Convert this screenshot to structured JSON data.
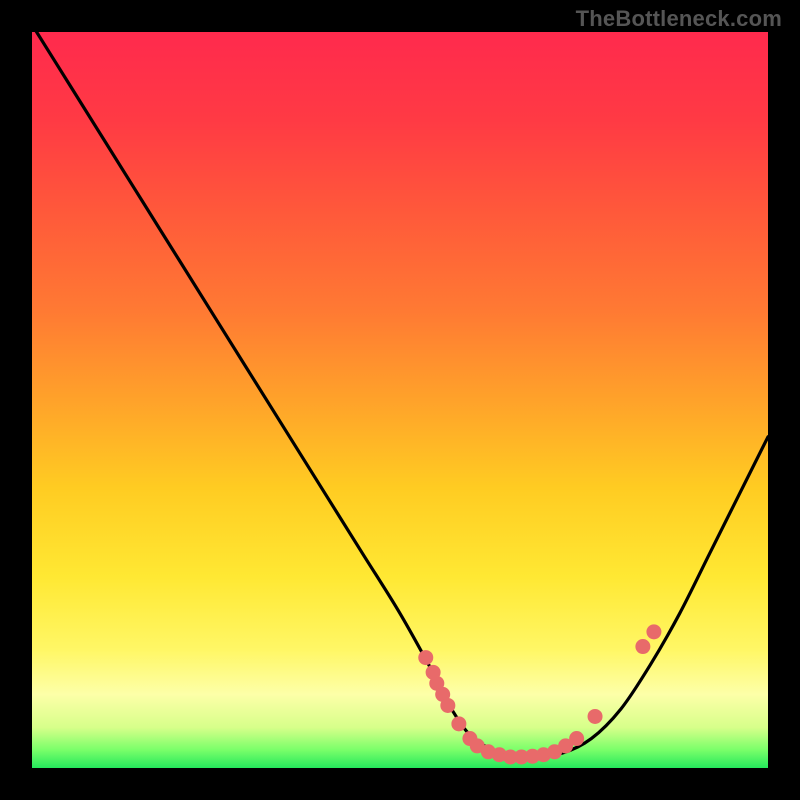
{
  "watermark": "TheBottleneck.com",
  "chart_data": {
    "type": "line",
    "title": "",
    "xlabel": "",
    "ylabel": "",
    "xlim": [
      0,
      100
    ],
    "ylim": [
      0,
      100
    ],
    "series": [
      {
        "name": "curve",
        "x": [
          0,
          5,
          10,
          15,
          20,
          25,
          30,
          35,
          40,
          45,
          50,
          55,
          57,
          60,
          64,
          68,
          72,
          76,
          80,
          84,
          88,
          92,
          96,
          100
        ],
        "y": [
          101,
          93,
          85,
          77,
          69,
          61,
          53,
          45,
          37,
          29,
          21,
          12,
          8,
          4,
          2,
          1.5,
          2,
          4,
          8,
          14,
          21,
          29,
          37,
          45
        ]
      }
    ],
    "scatter": {
      "name": "dots",
      "color": "#e86a6a",
      "points": [
        {
          "x": 53.5,
          "y": 15.0
        },
        {
          "x": 54.5,
          "y": 13.0
        },
        {
          "x": 55.0,
          "y": 11.5
        },
        {
          "x": 55.8,
          "y": 10.0
        },
        {
          "x": 56.5,
          "y": 8.5
        },
        {
          "x": 58.0,
          "y": 6.0
        },
        {
          "x": 59.5,
          "y": 4.0
        },
        {
          "x": 60.5,
          "y": 3.0
        },
        {
          "x": 62.0,
          "y": 2.2
        },
        {
          "x": 63.5,
          "y": 1.8
        },
        {
          "x": 65.0,
          "y": 1.5
        },
        {
          "x": 66.5,
          "y": 1.5
        },
        {
          "x": 68.0,
          "y": 1.6
        },
        {
          "x": 69.5,
          "y": 1.8
        },
        {
          "x": 71.0,
          "y": 2.2
        },
        {
          "x": 72.5,
          "y": 3.0
        },
        {
          "x": 74.0,
          "y": 4.0
        },
        {
          "x": 76.5,
          "y": 7.0
        },
        {
          "x": 83.0,
          "y": 16.5
        },
        {
          "x": 84.5,
          "y": 18.5
        }
      ]
    },
    "gradient_stops": [
      {
        "offset": 0.0,
        "color": "#ff2a4d"
      },
      {
        "offset": 0.12,
        "color": "#ff3a44"
      },
      {
        "offset": 0.25,
        "color": "#ff5a3a"
      },
      {
        "offset": 0.38,
        "color": "#ff7a33"
      },
      {
        "offset": 0.5,
        "color": "#ffa22a"
      },
      {
        "offset": 0.62,
        "color": "#ffcc22"
      },
      {
        "offset": 0.74,
        "color": "#ffe833"
      },
      {
        "offset": 0.84,
        "color": "#fff766"
      },
      {
        "offset": 0.9,
        "color": "#fdffa8"
      },
      {
        "offset": 0.945,
        "color": "#d7ff8a"
      },
      {
        "offset": 0.975,
        "color": "#7bff6a"
      },
      {
        "offset": 1.0,
        "color": "#25e85c"
      }
    ]
  }
}
